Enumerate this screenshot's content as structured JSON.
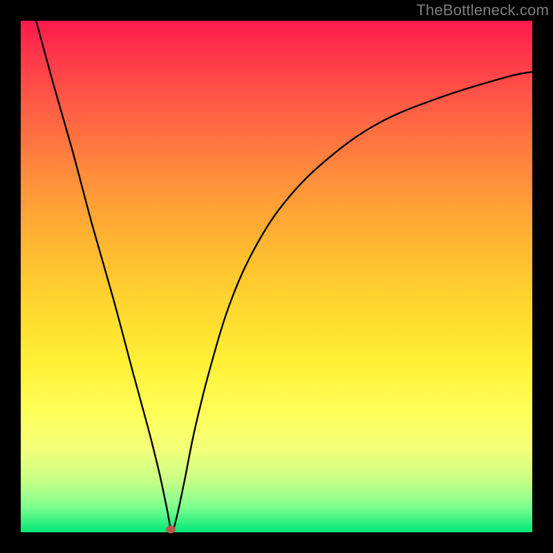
{
  "watermark": "TheBottleneck.com",
  "colors": {
    "frame": "#000000",
    "curve": "#000000",
    "marker": "#b55a4a",
    "gradient_stops": [
      "#ff1a4d",
      "#ff3b4a",
      "#ff5a46",
      "#ff7a3f",
      "#ff9a38",
      "#ffb831",
      "#ffd52e",
      "#ffee35",
      "#ffff55",
      "#f2ff7a",
      "#c6ff86",
      "#7fff8f",
      "#00e878"
    ]
  },
  "chart_data": {
    "type": "line",
    "title": "",
    "xlabel": "",
    "ylabel": "",
    "xlim": [
      0,
      100
    ],
    "ylim": [
      0,
      100
    ],
    "grid": false,
    "note": "Axes unlabeled; values are estimated positions in percent of plot area. y=0 at bottom (green), y=100 at top (red). Curve is a V/funnel shape with minimum near x≈29.",
    "series": [
      {
        "name": "bottleneck-curve",
        "x": [
          3,
          6,
          10,
          14,
          18,
          22,
          25,
          27,
          28.5,
          29.5,
          30.5,
          32,
          34,
          37,
          41,
          46,
          52,
          60,
          70,
          82,
          95,
          100
        ],
        "y": [
          100,
          89,
          75,
          60,
          46,
          31,
          20,
          12,
          5,
          0.5,
          3,
          10,
          20,
          32,
          45,
          56,
          65,
          73,
          80,
          85,
          89,
          90
        ]
      }
    ],
    "marker": {
      "x": 29.3,
      "y": 0.5
    }
  }
}
